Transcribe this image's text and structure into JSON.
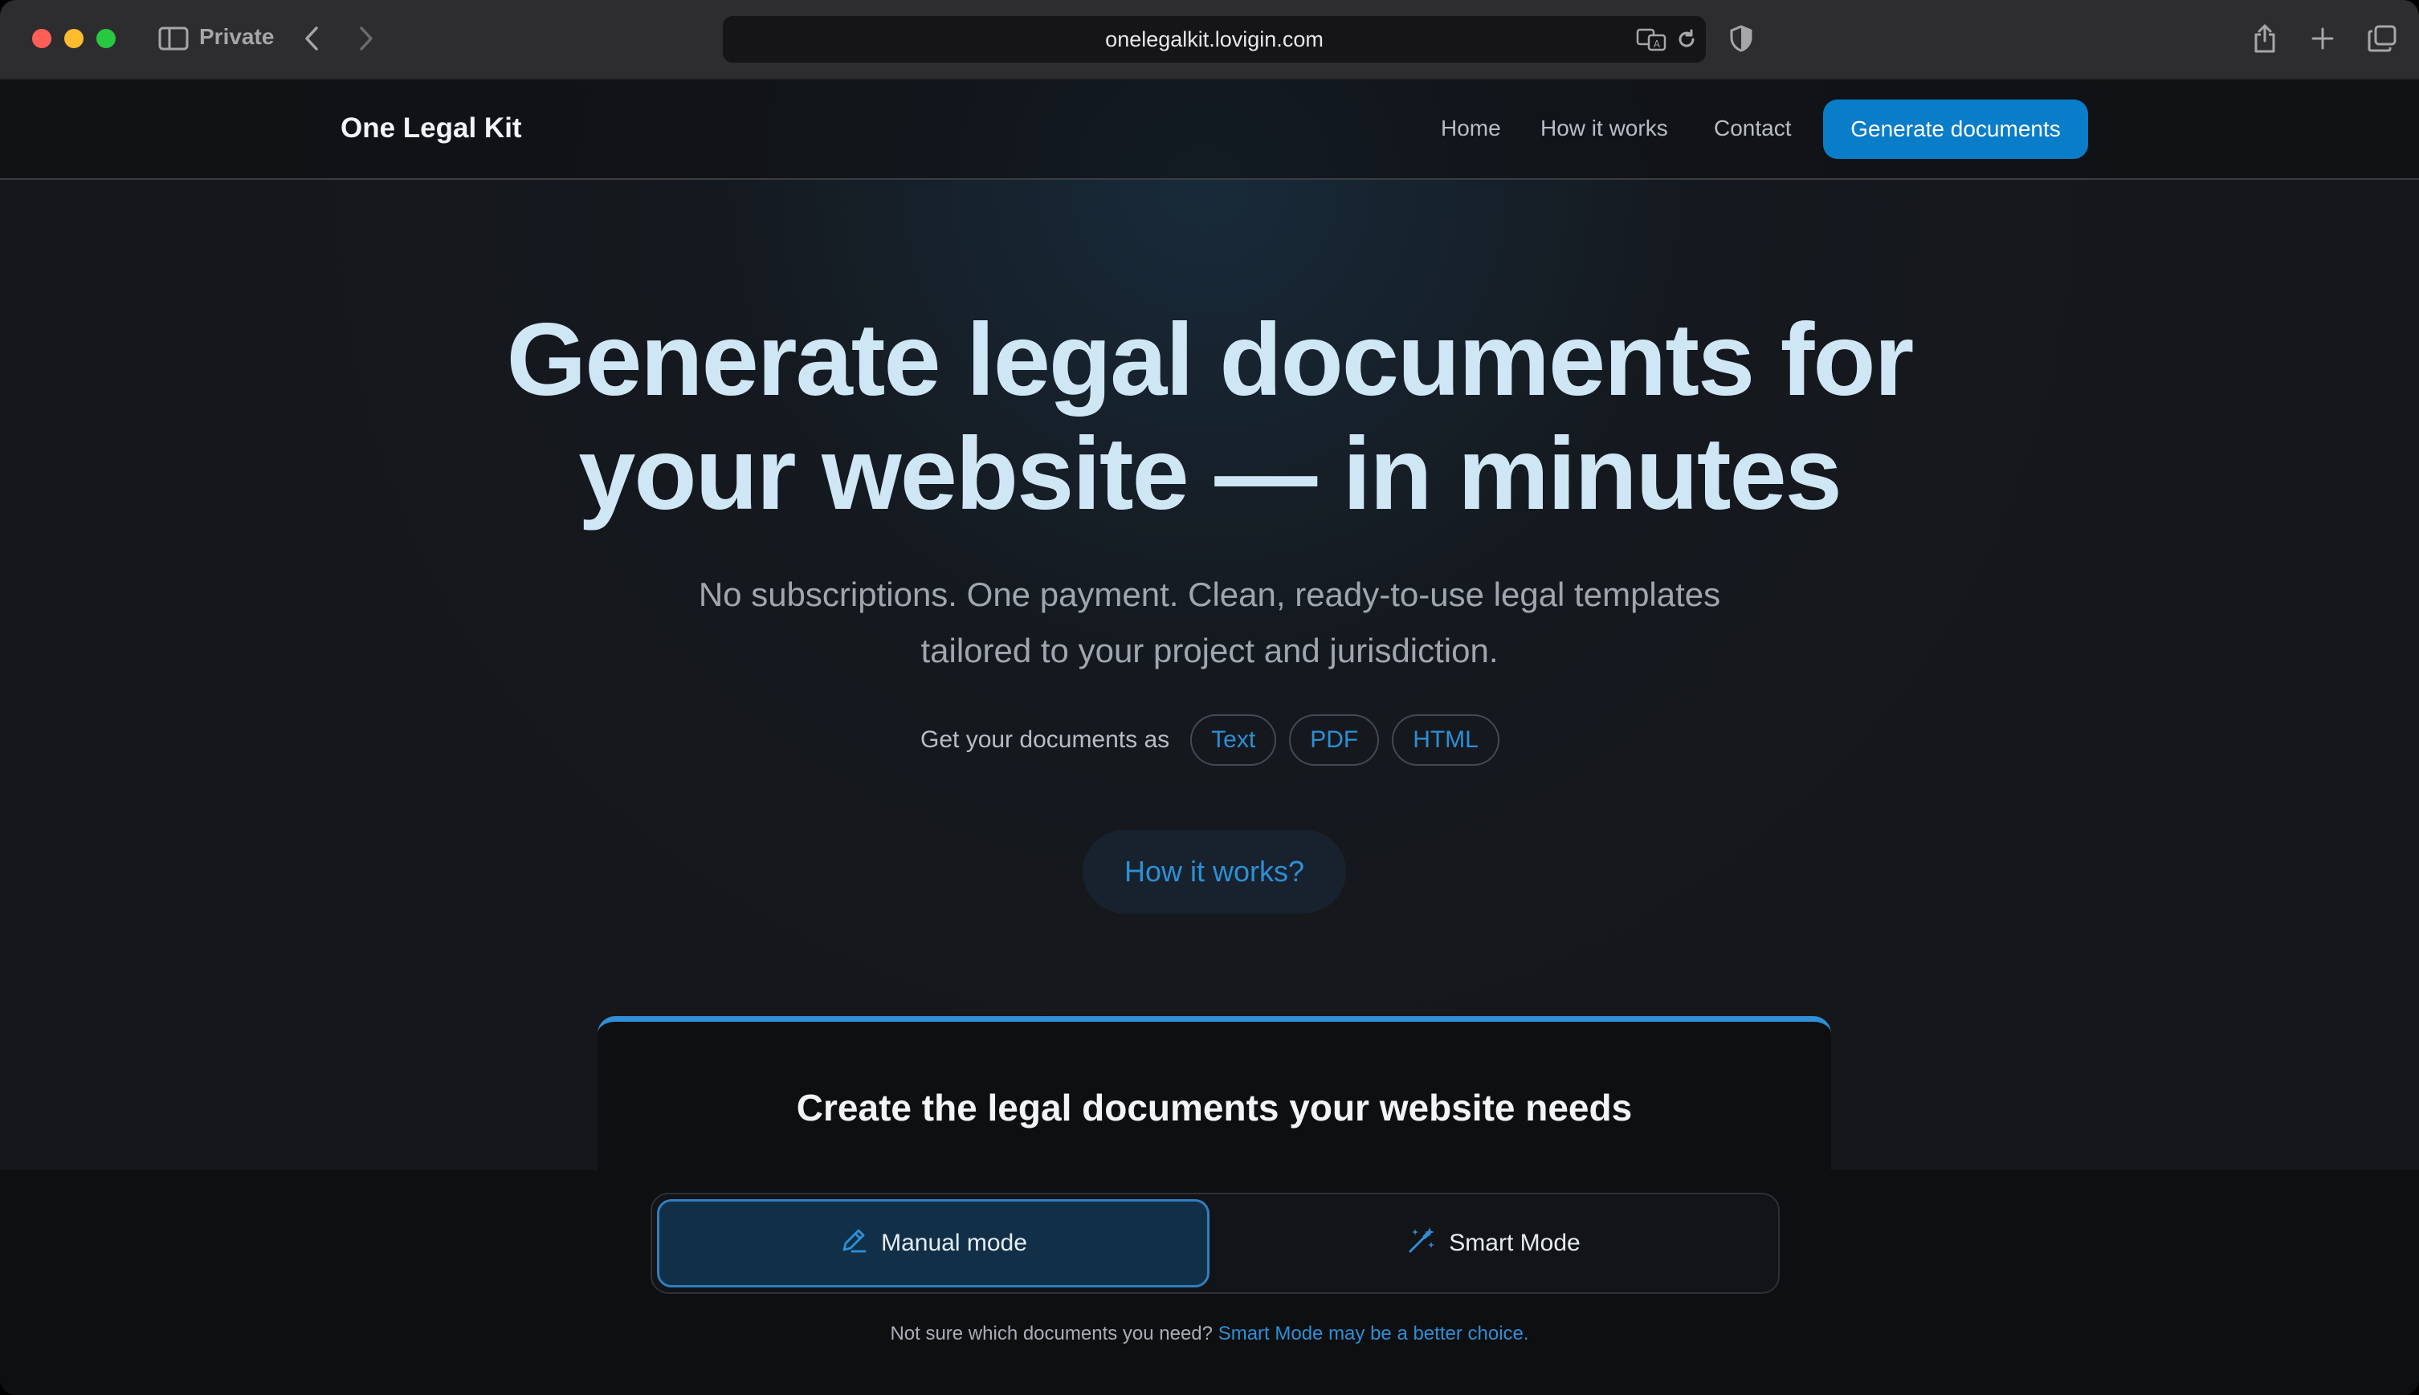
{
  "browser": {
    "private_label": "Private",
    "url": "onelegalkit.lovigin.com"
  },
  "nav": {
    "brand": "One Legal Kit",
    "links": [
      "Home",
      "How it works",
      "Contact"
    ],
    "cta": "Generate documents"
  },
  "hero": {
    "title_line1": "Generate legal documents for",
    "title_line2": "your website — in minutes",
    "subtitle_line1": "No subscriptions. One payment. Clean, ready-to-use legal templates",
    "subtitle_line2": "tailored to your project and jurisdiction.",
    "formats_label": "Get your documents as",
    "formats": [
      "Text",
      "PDF",
      "HTML"
    ],
    "how_button": "How it works?"
  },
  "card": {
    "title": "Create the legal documents your website needs",
    "modes": {
      "manual": "Manual mode",
      "smart": "Smart Mode"
    },
    "selected_mode": "manual",
    "hint_text": "Not sure which documents you need?",
    "hint_link": "Smart Mode may be a better choice."
  },
  "colors": {
    "accent": "#0a7dc9",
    "link": "#2d8fd6",
    "title": "#cfe6f5"
  },
  "icons": {
    "sidebar": "sidebar-icon",
    "back": "chevron-left-icon",
    "forward": "chevron-right-icon",
    "translate": "translate-icon",
    "reload": "reload-icon",
    "shield": "shield-icon",
    "share": "share-icon",
    "new_tab": "plus-icon",
    "tabs": "tabs-overview-icon",
    "manual_mode": "pencil-icon",
    "smart_mode": "magic-wand-icon"
  }
}
